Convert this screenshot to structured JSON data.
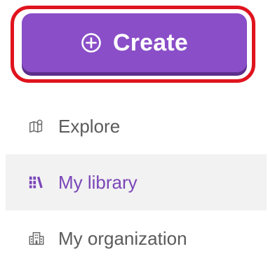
{
  "create_button": {
    "label": "Create",
    "icon": "plus-circle-icon"
  },
  "nav": {
    "items": [
      {
        "label": "Explore",
        "icon": "map-icon",
        "active": false
      },
      {
        "label": "My library",
        "icon": "library-icon",
        "active": true
      },
      {
        "label": "My organization",
        "icon": "building-icon",
        "active": false
      }
    ]
  },
  "colors": {
    "accent": "#8a4ec8",
    "accent_dark": "#5c2f8c",
    "active_text": "#7a46b8",
    "active_bg": "#f2f2f2",
    "text": "#5b5b5b",
    "highlight": "#e0141e"
  }
}
